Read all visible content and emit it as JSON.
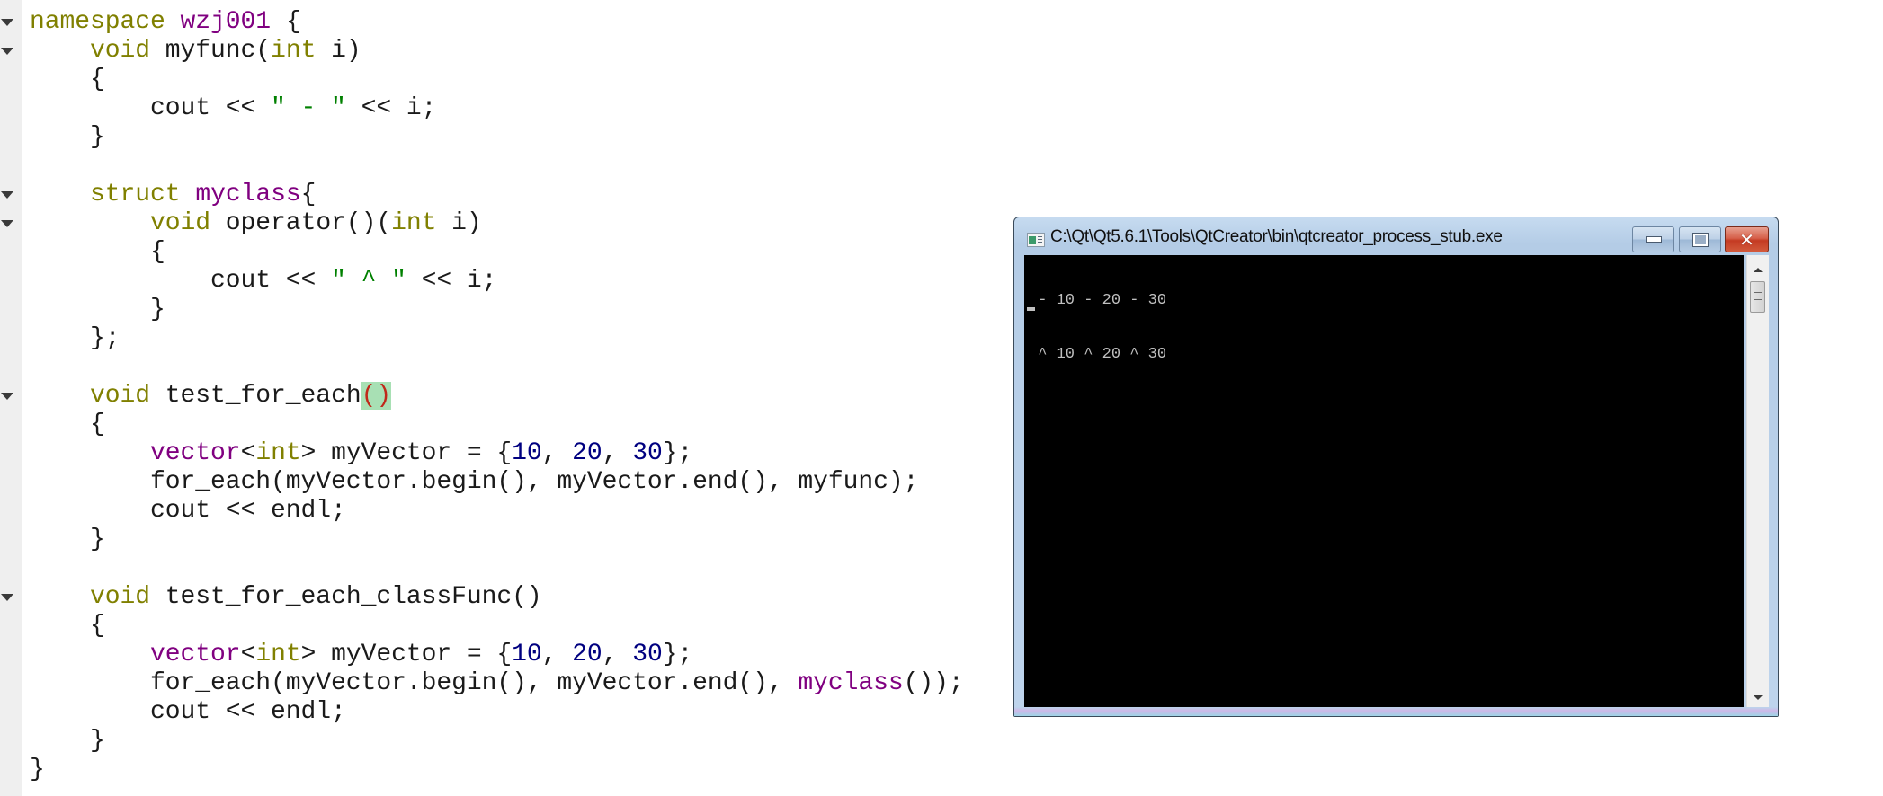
{
  "editor": {
    "fold_lines": [
      1,
      2,
      7,
      8,
      14,
      21
    ],
    "colors": {
      "keyword": "#808000",
      "type": "#800080",
      "string": "#008000",
      "number": "#000080",
      "bracket_match_bg": "#a8e0b4",
      "bracket_match_fg": "#c0281a"
    },
    "lines": [
      [
        {
          "t": "namespace",
          "c": "kw"
        },
        {
          "t": " "
        },
        {
          "t": "wzj001",
          "c": "ty"
        },
        {
          "t": " {"
        }
      ],
      [
        {
          "t": "    "
        },
        {
          "t": "void",
          "c": "kw"
        },
        {
          "t": " myfunc("
        },
        {
          "t": "int",
          "c": "kw"
        },
        {
          "t": " i)"
        }
      ],
      [
        {
          "t": "    {"
        }
      ],
      [
        {
          "t": "        cout << "
        },
        {
          "t": "\" - \"",
          "c": "str"
        },
        {
          "t": " << i;"
        }
      ],
      [
        {
          "t": "    }"
        }
      ],
      [
        {
          "t": ""
        }
      ],
      [
        {
          "t": "    "
        },
        {
          "t": "struct",
          "c": "kw"
        },
        {
          "t": " "
        },
        {
          "t": "myclass",
          "c": "ty"
        },
        {
          "t": "{"
        }
      ],
      [
        {
          "t": "        "
        },
        {
          "t": "void",
          "c": "kw"
        },
        {
          "t": " operator()("
        },
        {
          "t": "int",
          "c": "kw"
        },
        {
          "t": " i)"
        }
      ],
      [
        {
          "t": "        {"
        }
      ],
      [
        {
          "t": "            cout << "
        },
        {
          "t": "\" ^ \"",
          "c": "str"
        },
        {
          "t": " << i;"
        }
      ],
      [
        {
          "t": "        }"
        }
      ],
      [
        {
          "t": "    };"
        }
      ],
      [
        {
          "t": ""
        }
      ],
      [
        {
          "t": "    "
        },
        {
          "t": "void",
          "c": "kw"
        },
        {
          "t": " test_for_each"
        },
        {
          "t": "()",
          "c": "hl"
        }
      ],
      [
        {
          "t": "    {"
        }
      ],
      [
        {
          "t": "        "
        },
        {
          "t": "vector",
          "c": "ty"
        },
        {
          "t": "<"
        },
        {
          "t": "int",
          "c": "kw"
        },
        {
          "t": "> myVector = {"
        },
        {
          "t": "10",
          "c": "num"
        },
        {
          "t": ", "
        },
        {
          "t": "20",
          "c": "num"
        },
        {
          "t": ", "
        },
        {
          "t": "30",
          "c": "num"
        },
        {
          "t": "};"
        }
      ],
      [
        {
          "t": "        for_each(myVector.begin(), myVector.end(), myfunc);"
        }
      ],
      [
        {
          "t": "        cout << endl;"
        }
      ],
      [
        {
          "t": "    }"
        }
      ],
      [
        {
          "t": ""
        }
      ],
      [
        {
          "t": "    "
        },
        {
          "t": "void",
          "c": "kw"
        },
        {
          "t": " test_for_each_classFunc()"
        }
      ],
      [
        {
          "t": "    {"
        }
      ],
      [
        {
          "t": "        "
        },
        {
          "t": "vector",
          "c": "ty"
        },
        {
          "t": "<"
        },
        {
          "t": "int",
          "c": "kw"
        },
        {
          "t": "> myVector = {"
        },
        {
          "t": "10",
          "c": "num"
        },
        {
          "t": ", "
        },
        {
          "t": "20",
          "c": "num"
        },
        {
          "t": ", "
        },
        {
          "t": "30",
          "c": "num"
        },
        {
          "t": "};"
        }
      ],
      [
        {
          "t": "        for_each(myVector.begin(), myVector.end(), "
        },
        {
          "t": "myclass",
          "c": "ty"
        },
        {
          "t": "());"
        }
      ],
      [
        {
          "t": "        cout << endl;"
        }
      ],
      [
        {
          "t": "    }"
        }
      ],
      [
        {
          "t": "}"
        }
      ]
    ]
  },
  "console_window": {
    "title": "C:\\Qt\\Qt5.6.1\\Tools\\QtCreator\\bin\\qtcreator_process_stub.exe",
    "icon": "console-app-icon",
    "buttons": {
      "minimize_icon": "minimize-icon",
      "maximize_icon": "maximize-icon",
      "close_icon": "close-icon",
      "close_glyph": "✕"
    },
    "output_lines": [
      " - 10 - 20 - 30",
      " ^ 10 ^ 20 ^ 30"
    ],
    "colors": {
      "background": "#000000",
      "text": "#c0c0c0",
      "close_button": "#c43a22"
    }
  }
}
